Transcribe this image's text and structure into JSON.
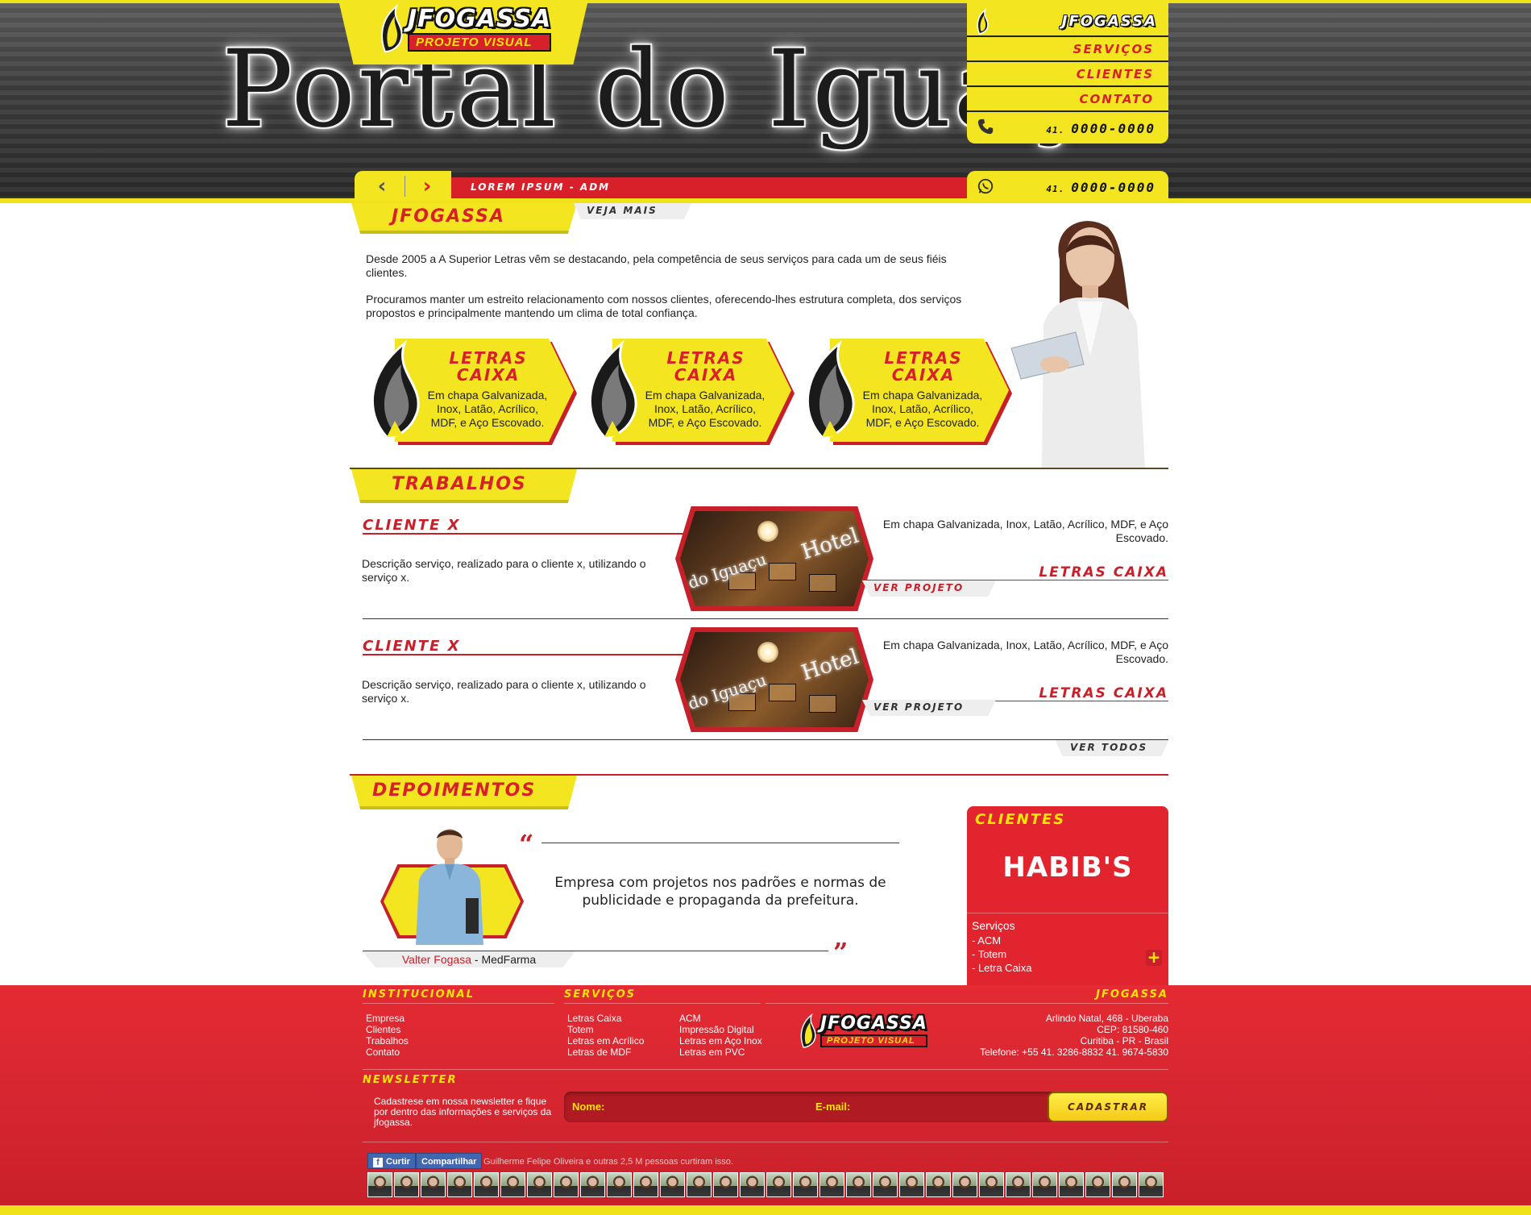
{
  "brand": {
    "name": "JFOGASSA",
    "tagline": "PROJETO VISUAL",
    "colors": {
      "yellow": "#f4e521",
      "red": "#d8202a",
      "dark": "#222222"
    }
  },
  "hero": {
    "title": "Portal do Iguaçu",
    "caption": "LOREM IPSUM - ADM",
    "prev_icon": "chevron-left-icon",
    "next_icon": "chevron-right-icon"
  },
  "nav": {
    "brand": "JFOGASSA",
    "items": [
      {
        "label": "SERVIÇOS"
      },
      {
        "label": "CLIENTES"
      },
      {
        "label": "CONTATO"
      }
    ],
    "phone": {
      "prefix": "41.",
      "number": "0000-0000"
    },
    "whatsapp": {
      "prefix": "41.",
      "number": "0000-0000"
    }
  },
  "about": {
    "tab": "JFOGASSA",
    "more": "VEJA MAIS",
    "p1": "Desde 2005 a A Superior Letras vêm se destacando, pela competência de seus serviços para cada um de seus fiéis clientes.",
    "p2": "Procuramos manter um estreito relacionamento com nossos clientes, oferecendo-lhes estrutura completa, dos serviços propostos e principalmente mantendo um clima de total confiança."
  },
  "services": [
    {
      "title1": "LETRAS",
      "title2": "CAIXA",
      "desc": "Em chapa Galvanizada, Inox, Latão, Acrílico, MDF, e Aço Escovado."
    },
    {
      "title1": "LETRAS",
      "title2": "CAIXA",
      "desc": "Em chapa Galvanizada, Inox, Latão, Acrílico, MDF, e Aço Escovado."
    },
    {
      "title1": "LETRAS",
      "title2": "CAIXA",
      "desc": "Em chapa Galvanizada, Inox, Latão, Acrílico, MDF, e Aço Escovado."
    }
  ],
  "works": {
    "tab": "TRABALHOS",
    "see_all": "VER TODOS",
    "items": [
      {
        "client": "CLIENTE X",
        "desc": "Descrição serviço, realizado para o cliente x, utilizando o serviço x.",
        "material": "Em chapa Galvanizada, Inox, Latão, Acrílico, MDF, e Aço Escovado.",
        "category": "LETRAS CAIXA",
        "cta": "VER PROJETO",
        "img_text1": "Hotel",
        "img_text2": "do Iguaçu"
      },
      {
        "client": "CLIENTE X",
        "desc": "Descrição serviço, realizado para o cliente x, utilizando o serviço x.",
        "material": "Em chapa Galvanizada, Inox, Latão, Acrílico, MDF, e Aço Escovado.",
        "category": "LETRAS CAIXA",
        "cta": "VER PROJETO",
        "img_text1": "Hotel",
        "img_text2": "do Iguaçu"
      }
    ]
  },
  "testimonials": {
    "tab": "DEPOIMENTOS",
    "quote": "Empresa com projetos nos padrões e normas de publicidade e propaganda da prefeitura.",
    "author": "Valter Fogasa",
    "sep": " - ",
    "company": "MedFarma"
  },
  "clients": {
    "title": "CLIENTES",
    "logo": "HABIB'S",
    "services_label": "Serviços",
    "services": [
      "- ACM",
      "- Totem",
      "- Letra Caixa"
    ],
    "plus": "+"
  },
  "footer": {
    "inst_title": "INSTITUCIONAL",
    "inst_links": [
      "Empresa",
      "Clientes",
      "Trabalhos",
      "Contato"
    ],
    "serv_title": "SERVIÇOS",
    "serv_col1": [
      "Letras Caixa",
      "Totem",
      "Letras em Acrílico",
      "Letras de MDF"
    ],
    "serv_col2": [
      "ACM",
      "Impressão Digital",
      "Letras em Aço Inox",
      "Letras em PVC"
    ],
    "brand_title": "JFOGASSA",
    "address": [
      "Arlindo Natal, 468 - Uberaba",
      "CEP: 81580-460",
      "Curitiba - PR - Brasil",
      "Telefone: +55 41. 3286-8832 41. 9674-5830"
    ],
    "newsletter_title": "NEWSLETTER",
    "newsletter_text": "Cadastrese em nossa newsletter e fique por dentro das informações e serviços da jfogassa.",
    "name_label": "Nome:",
    "email_label": "E-mail:",
    "submit": "CADASTRAR",
    "fb_like": "Curtir",
    "fb_share": "Compartilhar",
    "fb_text": "Guilherme Felipe Oliveira e outras 2,5 M pessoas curtiram isso."
  }
}
